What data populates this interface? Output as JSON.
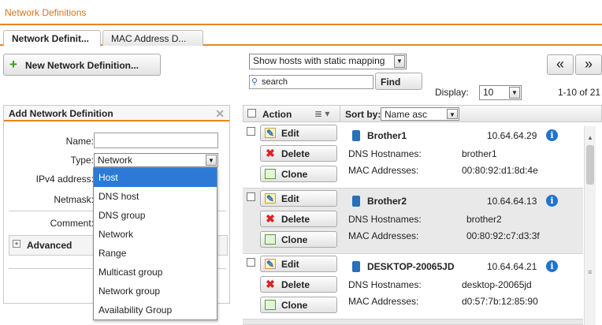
{
  "header": {
    "title": "Network Definitions"
  },
  "tabs": [
    {
      "label": "Network Definit..."
    },
    {
      "label": "MAC Address D..."
    }
  ],
  "toolbar": {
    "new_button": "New Network Definition...",
    "filter_select": "Show hosts with static mapping",
    "search_placeholder": "search",
    "find_button": "Find",
    "display_label": "Display:",
    "display_value": "10",
    "range_text": "1-10 of 21",
    "prev_label": "«",
    "next_label": "»"
  },
  "add_panel": {
    "title": "Add Network Definition",
    "name_label": "Name:",
    "type_label": "Type:",
    "type_value": "Network",
    "ipv4_label": "IPv4 address:",
    "netmask_label": "Netmask:",
    "comment_label": "Comment:",
    "advanced_label": "Advanced"
  },
  "type_dropdown": {
    "options": [
      "Host",
      "DNS host",
      "DNS group",
      "Network",
      "Range",
      "Multicast group",
      "Network group",
      "Availability Group"
    ],
    "highlighted": "Host"
  },
  "list": {
    "action_header": "Action",
    "sort_label": "Sort by:",
    "sort_value": "Name asc",
    "edit_label": "Edit",
    "delete_label": "Delete",
    "clone_label": "Clone",
    "dns_label": "DNS Hostnames:",
    "mac_label": "MAC Addresses:",
    "rows": [
      {
        "name": "Brother1",
        "ip": "10.64.64.29",
        "dns": "brother1",
        "mac": "00:80:92:d1:8d:4e"
      },
      {
        "name": "Brother2",
        "ip": "10.64.64.13",
        "dns": "brother2",
        "mac": "00:80:92:c7:d3:3f"
      },
      {
        "name": "DESKTOP-20065JD",
        "ip": "10.64.64.21",
        "dns": "desktop-20065jd",
        "mac": "d0:57:7b:12:85:90"
      }
    ]
  },
  "colors": {
    "accent": "#e8861e",
    "title_text": "#d9741a",
    "selection": "#2d7ad6",
    "link_blue": "#1f73cc"
  }
}
